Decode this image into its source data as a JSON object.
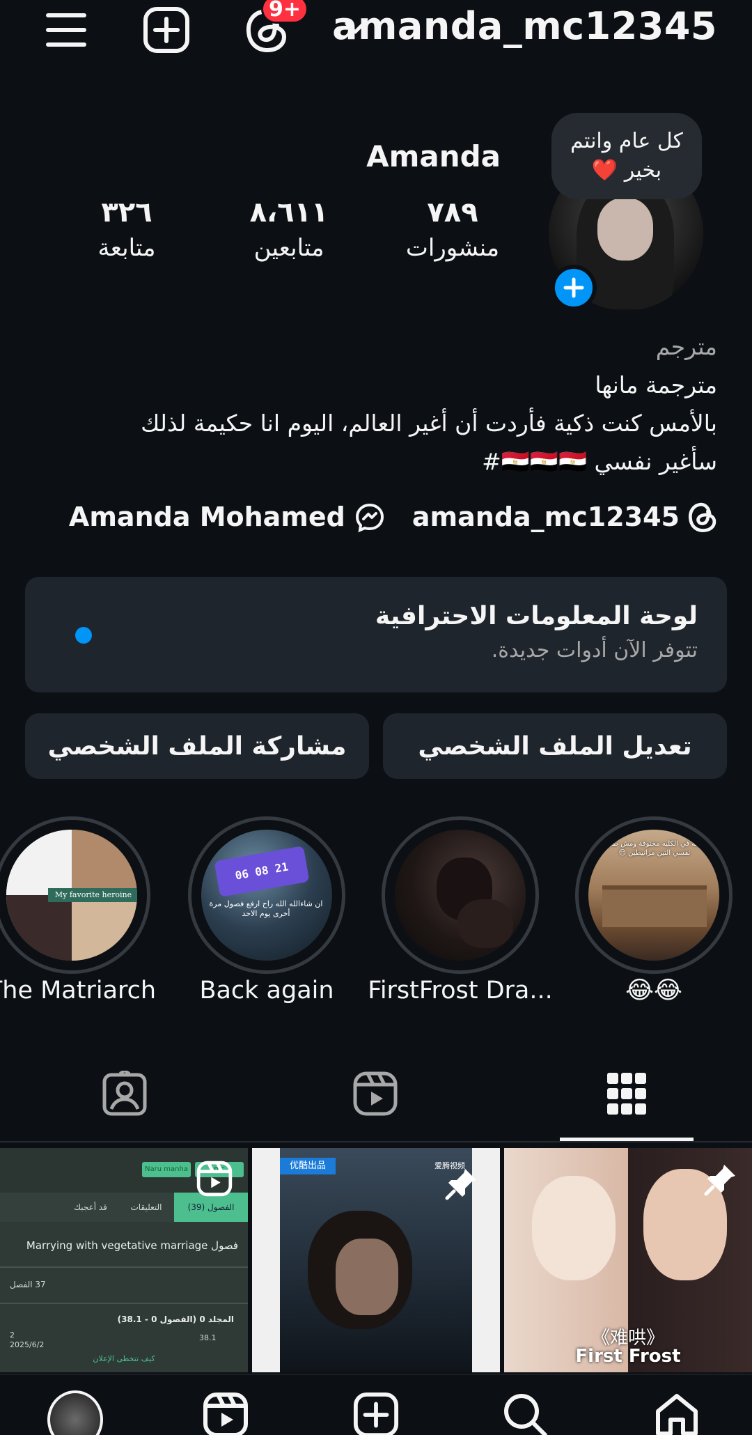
{
  "topbar": {
    "username": "amanda_mc12345",
    "threads_badge": "9+",
    "icons": [
      "menu-icon",
      "add-post-icon",
      "threads-icon",
      "chevron-down-icon"
    ]
  },
  "profile": {
    "display_name": "Amanda",
    "note": "كل عام وانتم بخير ❤️",
    "stats": [
      {
        "num": "٣٢٦",
        "label": "متابعة"
      },
      {
        "num": "٨،٦١١",
        "label": "متابعين"
      },
      {
        "num": "٧٨٩",
        "label": "منشورات"
      }
    ]
  },
  "bio": {
    "category": "مترجم",
    "lines": [
      "مترجمة مانها",
      "بالأمس كنت ذكية فأردت أن أغير العالم، اليوم انا حكيمة لذلك",
      "سأغير نفسي 🇪🇬🇪🇬🇪🇬#"
    ]
  },
  "links": {
    "threads_handle": "amanda_mc12345",
    "messenger_name": "Amanda Mohamed"
  },
  "dashboard": {
    "title": "لوحة المعلومات الاحترافية",
    "subtitle": "تتوفر الآن أدوات جديدة."
  },
  "buttons": {
    "edit_profile": "تعديل الملف الشخصي",
    "share_profile": "مشاركة الملف الشخصي"
  },
  "highlights": [
    {
      "label": "The Matriarch"
    },
    {
      "label": "Back again"
    },
    {
      "label": "FirstFrost Dra..."
    },
    {
      "label": "😂😂"
    }
  ],
  "highlight_overlays": {
    "matriarch": "My favorite heroine",
    "back_again_timer": "06 08 21",
    "back_again_text": "ان شاءالله الله راح ارفع فصول مرة أخرى يوم الاحد",
    "emoji_text": "واقفة في الكليه مخنوقة ومش طايقه نفسي التين مزانيطين 😑"
  },
  "tabs": [
    "tagged-tab",
    "reels-tab",
    "grid-tab"
  ],
  "grid_post1": {
    "tag1": "Naru manha",
    "tag2": "mc",
    "tabs": [
      "الفصول (39)",
      "التعليقات",
      "قد أعجبك"
    ],
    "title": "Marrying with vegetative marriage فصول",
    "chapter": "37 الفصل",
    "volume": "المجلد 0 (الفصول 0 - 38.1)",
    "views": "2",
    "date": "2025/6/2",
    "item_num": "38.1",
    "footer": "كيف تتخطى الإعلان"
  },
  "grid_post2": {
    "brand": "优酷出品",
    "logo": "爱腾视频"
  },
  "grid_post3": {
    "title_cn": "《难哄》",
    "title_en": "First Frost"
  },
  "colors": {
    "background": "#0c1014",
    "card": "#1f252c",
    "accent_blue": "#0095f6",
    "badge_red": "#ff3040",
    "muted_text": "#a8a8a8"
  }
}
